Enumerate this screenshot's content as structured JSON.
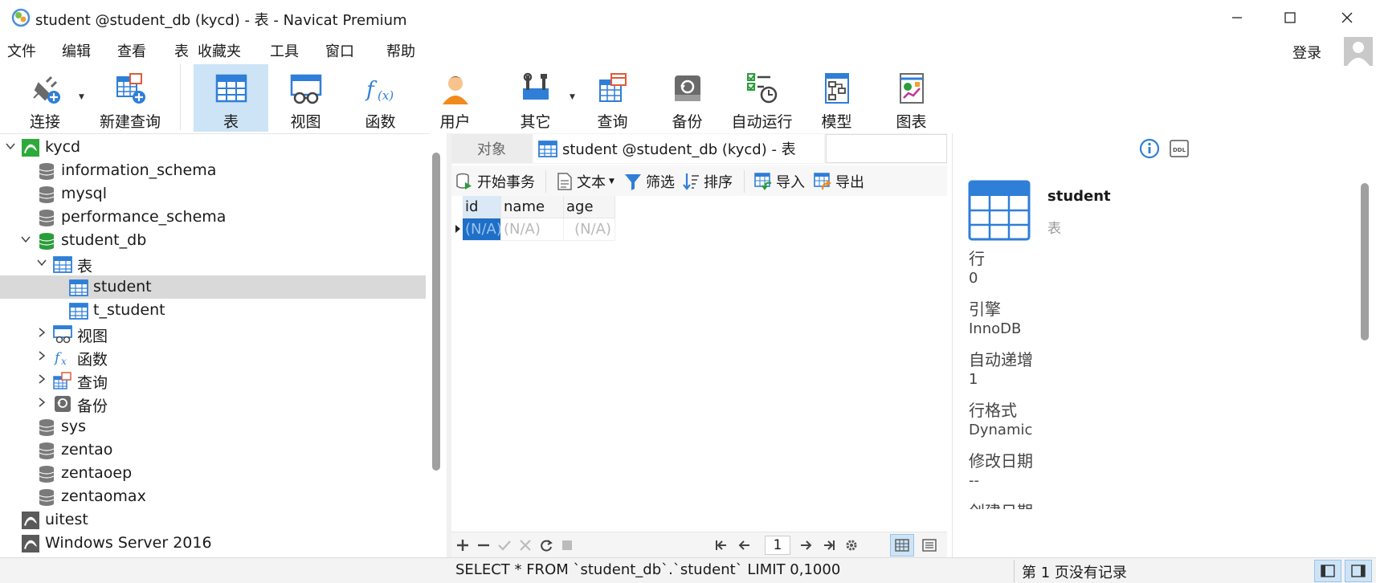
{
  "window": {
    "title": "student @student_db (kycd) - 表 - Navicat Premium"
  },
  "menu": {
    "items": [
      "文件",
      "编辑",
      "查看",
      "表",
      "收藏夹",
      "工具",
      "窗口",
      "帮助"
    ],
    "login": "登录"
  },
  "toolbar": {
    "items": [
      {
        "label": "连接",
        "icon": "connection-plug-icon"
      },
      {
        "label": "新建查询",
        "icon": "new-query-icon"
      },
      {
        "label": "表",
        "icon": "table-icon",
        "active": true
      },
      {
        "label": "视图",
        "icon": "view-icon"
      },
      {
        "label": "函数",
        "icon": "function-icon"
      },
      {
        "label": "用户",
        "icon": "user-icon"
      },
      {
        "label": "其它",
        "icon": "tools-icon"
      },
      {
        "label": "查询",
        "icon": "query-icon"
      },
      {
        "label": "备份",
        "icon": "backup-icon"
      },
      {
        "label": "自动运行",
        "icon": "automation-icon"
      },
      {
        "label": "模型",
        "icon": "model-icon"
      },
      {
        "label": "图表",
        "icon": "chart-icon"
      }
    ]
  },
  "tree": {
    "items": [
      {
        "label": "kycd",
        "icon": "connection-icon"
      },
      {
        "label": "information_schema",
        "icon": "database-icon"
      },
      {
        "label": "mysql",
        "icon": "database-icon"
      },
      {
        "label": "performance_schema",
        "icon": "database-icon"
      },
      {
        "label": "student_db",
        "icon": "database-open-icon"
      },
      {
        "label": "表",
        "icon": "table-folder-icon"
      },
      {
        "label": "student",
        "icon": "table-icon",
        "selected": true
      },
      {
        "label": "t_student",
        "icon": "table-icon"
      },
      {
        "label": "视图",
        "icon": "view-folder-icon"
      },
      {
        "label": "函数",
        "icon": "function-folder-icon"
      },
      {
        "label": "查询",
        "icon": "query-folder-icon"
      },
      {
        "label": "备份",
        "icon": "backup-folder-icon"
      },
      {
        "label": "sys",
        "icon": "database-icon"
      },
      {
        "label": "zentao",
        "icon": "database-icon"
      },
      {
        "label": "zentaoep",
        "icon": "database-icon"
      },
      {
        "label": "zentaomax",
        "icon": "database-icon"
      },
      {
        "label": "uitest",
        "icon": "connection-icon"
      },
      {
        "label": "Windows Server 2016",
        "icon": "connection-icon"
      }
    ]
  },
  "tabs": {
    "objects": "对象",
    "active": "student @student_db (kycd) - 表"
  },
  "subtoolbar": {
    "begin_transaction": "开始事务",
    "text": "文本",
    "filter": "筛选",
    "sort": "排序",
    "import": "导入",
    "export": "导出"
  },
  "grid": {
    "columns": [
      "id",
      "name",
      "age"
    ],
    "row": [
      "(N/A)",
      "(N/A)",
      "(N/A)"
    ]
  },
  "nav": {
    "page": "1"
  },
  "properties": {
    "name": "student",
    "type": "表",
    "items": [
      {
        "label": "行",
        "value": "0"
      },
      {
        "label": "引擎",
        "value": "InnoDB"
      },
      {
        "label": "自动递增",
        "value": "1"
      },
      {
        "label": "行格式",
        "value": "Dynamic"
      },
      {
        "label": "修改日期",
        "value": "--"
      },
      {
        "label": "创建日期",
        "value": ""
      }
    ]
  },
  "status": {
    "sql": "SELECT * FROM `student_db`.`student` LIMIT 0,1000",
    "page_info": "第 1 页没有记录"
  },
  "colors": {
    "accent": "#2f7ed8",
    "active_toolbar": "#cde4f7",
    "selected_row": "#d9d9d9"
  }
}
